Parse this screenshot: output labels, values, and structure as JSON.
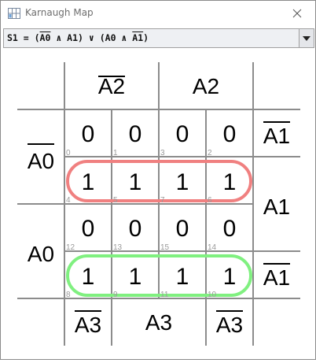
{
  "window": {
    "title": "Karnaugh Map",
    "icon": "app-grid-icon",
    "close_icon": "close-icon"
  },
  "expression": {
    "prefix": "S1 = (",
    "t1a": "A0",
    "and1": " ∧ A1) ∨ (A0 ∧ ",
    "t2b": "A1",
    "suffix": ")",
    "dropdown_icon": "chevron-down-icon"
  },
  "kmap": {
    "col_headers": {
      "top_left": "A2",
      "top_right": "A2",
      "bottom_left": "A3",
      "bottom_mid": "A3",
      "bottom_right": "A3"
    },
    "row_headers": {
      "left_top": "A0",
      "left_bottom": "A0",
      "right_1": "A1",
      "right_2": "A1",
      "right_4": "A1"
    },
    "cells": [
      [
        {
          "value": "0",
          "index": "0"
        },
        {
          "value": "0",
          "index": "1"
        },
        {
          "value": "0",
          "index": "3"
        },
        {
          "value": "0",
          "index": "2"
        }
      ],
      [
        {
          "value": "1",
          "index": "4"
        },
        {
          "value": "1",
          "index": "5"
        },
        {
          "value": "1",
          "index": "7"
        },
        {
          "value": "1",
          "index": "6"
        }
      ],
      [
        {
          "value": "0",
          "index": "12"
        },
        {
          "value": "0",
          "index": "13"
        },
        {
          "value": "0",
          "index": "15"
        },
        {
          "value": "0",
          "index": "14"
        }
      ],
      [
        {
          "value": "1",
          "index": "8"
        },
        {
          "value": "1",
          "index": "9"
        },
        {
          "value": "1",
          "index": "11"
        },
        {
          "value": "1",
          "index": "10"
        }
      ]
    ],
    "groups": [
      {
        "row": 1,
        "color": "#f08080"
      },
      {
        "row": 3,
        "color": "#80f080"
      }
    ],
    "line_color": "#8c8c8c"
  }
}
